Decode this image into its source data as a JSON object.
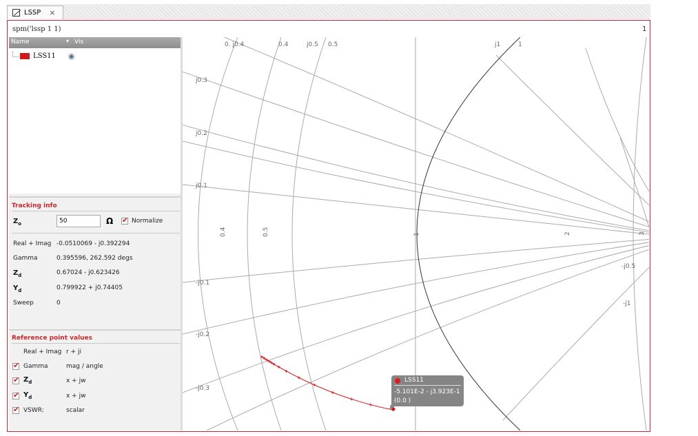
{
  "tab": {
    "label": "LSSP",
    "close": "×"
  },
  "command": "spm('lssp 1 1)",
  "corner_num": "1",
  "trace_table": {
    "col_name": "Name",
    "col_vis": "Vis",
    "sort_glyph": "▾",
    "rows": [
      {
        "name": "LSS11",
        "color": "#d21a1a",
        "vis_icon": "eye-icon"
      }
    ]
  },
  "tracking": {
    "title": "Tracking info",
    "z0_label": "Z",
    "z0_sub": "o",
    "z0_value": "50",
    "ohm": "Ω",
    "normalize_label": "Normalize",
    "fields": [
      {
        "label": "Real + Imag",
        "value": "-0.0510069 - j0.392294"
      },
      {
        "label": "Gamma",
        "value": "0.395596, 262.592 degs"
      },
      {
        "label": "Z",
        "sub": "d",
        "value": "0.67024 - j0.623426"
      },
      {
        "label": "Y",
        "sub": "d",
        "value": "0.799922 + j0.74405"
      },
      {
        "label": "Sweep",
        "value": "0"
      }
    ]
  },
  "reference": {
    "title": "Reference point values",
    "header_left": "Real + Imag",
    "header_right": "r + ji",
    "items": [
      {
        "label": "Gamma",
        "value": "mag / angle"
      },
      {
        "label": "Z",
        "sub": "d",
        "value": "x + jw"
      },
      {
        "label": "Y",
        "sub": "d",
        "value": "x + jw"
      },
      {
        "label": "VSWR:",
        "value": "scalar"
      }
    ]
  },
  "smith": {
    "top_labels": [
      "0. j0.4",
      "0.4",
      "j0.5",
      "0.5",
      "j1",
      "1"
    ],
    "left_labels": [
      "j0.3",
      "j0.2",
      "j0.1",
      "-j0.1",
      "-j0.2",
      "-j0.3"
    ],
    "axis_labels": [
      "0.4",
      "0.5",
      "1",
      "2",
      "3"
    ],
    "right_labels": [
      "-j0.5",
      "-j1"
    ],
    "trace_color": "#d21a1a"
  },
  "tooltip": {
    "name": "LSS11",
    "value": "-5.101E-2 - j3.923E-1",
    "index": "(0.0 )"
  }
}
